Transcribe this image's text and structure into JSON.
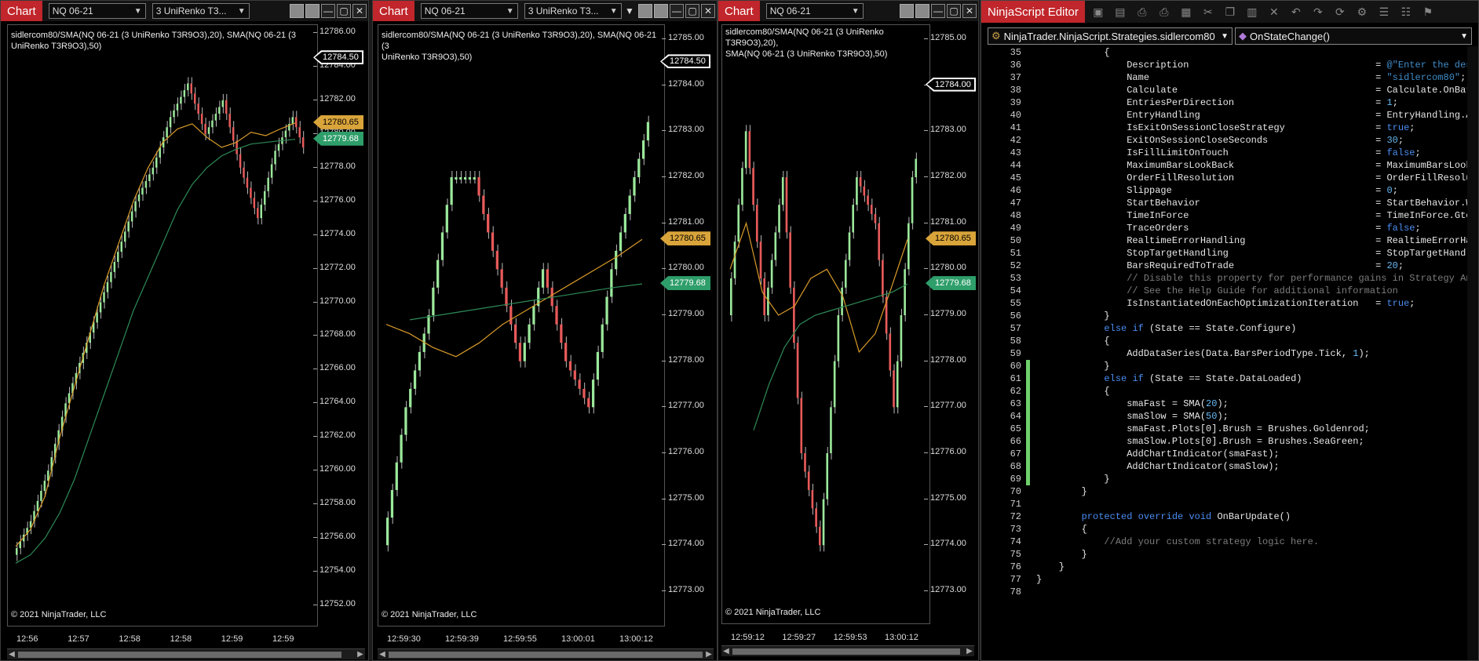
{
  "charts": [
    {
      "tab": "Chart",
      "instrument": "NQ 06-21",
      "bartype": "3 UniRenko T3...",
      "legend1": "sidlercom80/SMA(NQ 06-21 (3 UniRenko T3R9O3),20), SMA(NQ 06-21 (3",
      "legend2": "UniRenko T3R9O3),50)",
      "copyright": "© 2021 NinjaTrader, LLC",
      "ticks": [
        "12786.00",
        "12784.00",
        "12782.00",
        "12780.00",
        "12778.00",
        "12776.00",
        "12774.00",
        "12772.00",
        "12770.00",
        "12768.00",
        "12766.00",
        "12764.00",
        "12762.00",
        "12760.00",
        "12758.00",
        "12756.00",
        "12754.00",
        "12752.00"
      ],
      "last": "12784.50",
      "fast": "12780.65",
      "slow": "12779.68",
      "times": [
        "12:56",
        "12:57",
        "12:58",
        "12:58",
        "12:59",
        "12:59"
      ]
    },
    {
      "tab": "Chart",
      "instrument": "NQ 06-21",
      "bartype": "3 UniRenko T3...",
      "legend1": "sidlercom80/SMA(NQ 06-21 (3 UniRenko T3R9O3),20), SMA(NQ 06-21 (3",
      "legend2": "UniRenko T3R9O3),50)",
      "copyright": "© 2021 NinjaTrader, LLC",
      "ticks": [
        "12785.00",
        "12784.00",
        "12783.00",
        "12782.00",
        "12781.00",
        "12780.00",
        "12779.00",
        "12778.00",
        "12777.00",
        "12776.00",
        "12775.00",
        "12774.00",
        "12773.00"
      ],
      "last": "12784.50",
      "fast": "12780.65",
      "slow": "12779.68",
      "times": [
        "12:59:30",
        "12:59:39",
        "12:59:55",
        "13:00:01",
        "13:00:12"
      ]
    },
    {
      "tab": "Chart",
      "instrument": "NQ 06-21",
      "legend1": "sidlercom80/SMA(NQ 06-21 (3 UniRenko T3R9O3),20),",
      "legend2": "SMA(NQ 06-21 (3 UniRenko T3R9O3),50)",
      "copyright": "© 2021 NinjaTrader, LLC",
      "ticks": [
        "12785.00",
        "12784.00",
        "12783.00",
        "12782.00",
        "12781.00",
        "12780.00",
        "12779.00",
        "12778.00",
        "12777.00",
        "12776.00",
        "12775.00",
        "12774.00",
        "12773.00"
      ],
      "last": "12784.00",
      "fast": "12780.65",
      "slow": "12779.68",
      "times": [
        "12:59:12",
        "12:59:27",
        "12:59:53",
        "13:00:12"
      ]
    }
  ],
  "editor": {
    "title": "NinjaScript Editor",
    "class_combo": "NinjaTrader.NinjaScript.Strategies.sidlercom80",
    "method_combo": "OnStateChange()",
    "first_line": 35,
    "lines": [
      "            {",
      "                Description                                 = @\"Enter the des",
      "                Name                                        = \"sidlercom80\";",
      "                Calculate                                   = Calculate.OnBar",
      "                EntriesPerDirection                         = 1;",
      "                EntryHandling                               = EntryHandling.A",
      "                IsExitOnSessionCloseStrategy                = true;",
      "                ExitOnSessionCloseSeconds                   = 30;",
      "                IsFillLimitOnTouch                          = false;",
      "                MaximumBarsLookBack                         = MaximumBarsLook",
      "                OrderFillResolution                         = OrderFillResolu",
      "                Slippage                                    = 0;",
      "                StartBehavior                               = StartBehavior.W",
      "                TimeInForce                                 = TimeInForce.Gtc",
      "                TraceOrders                                 = false;",
      "                RealtimeErrorHandling                       = RealtimeErrorHa",
      "                StopTargetHandling                          = StopTargetHandl",
      "                BarsRequiredToTrade                         = 20;",
      "                // Disable this property for performance gains in Strategy An",
      "                // See the Help Guide for additional information",
      "                IsInstantiatedOnEachOptimizationIteration   = true;",
      "            }",
      "            else if (State == State.Configure)",
      "            {",
      "                AddDataSeries(Data.BarsPeriodType.Tick, 1);",
      "            }",
      "            else if (State == State.DataLoaded)",
      "            {",
      "                smaFast = SMA(20);",
      "                smaSlow = SMA(50);",
      "                smaFast.Plots[0].Brush = Brushes.Goldenrod;",
      "                smaSlow.Plots[0].Brush = Brushes.SeaGreen;",
      "                AddChartIndicator(smaFast);",
      "                AddChartIndicator(smaSlow);",
      "            }",
      "        }",
      "",
      "        protected override void OnBarUpdate()",
      "        {",
      "            //Add your custom strategy logic here.",
      "        }",
      "    }",
      "}",
      ""
    ]
  },
  "colors": {
    "up": "#9be89b",
    "down": "#e85a5a",
    "fast": "#d89a2a",
    "slow": "#2e8b57",
    "changed": "#6fd16a",
    "tab": "#c0262b"
  },
  "chart_data": [
    {
      "type": "line",
      "series": [
        {
          "values": [
            12755,
            12757,
            12760,
            12764,
            12767,
            12770,
            12773,
            12776,
            12778,
            12781,
            12783,
            12780,
            12782,
            12778,
            12775,
            12779,
            12781,
            12778,
            12781,
            12784
          ]
        },
        {
          "values": [
            12755.5,
            12756.5,
            12758.5,
            12762,
            12765,
            12768,
            12771,
            12773.5,
            12776,
            12778,
            12779.5,
            12780.3,
            12780.6,
            12779.8,
            12779.2,
            12779.5,
            12780.1,
            12779.9,
            12780.3,
            12780.65
          ]
        },
        {
          "values": [
            12754.5,
            12755,
            12756,
            12757.5,
            12759.5,
            12762,
            12764.5,
            12767,
            12769.5,
            12771.5,
            12773.5,
            12775.5,
            12777,
            12778,
            12778.7,
            12779.1,
            12779.4,
            12779.5,
            12779.6,
            12779.68
          ]
        }
      ]
    },
    {
      "type": "line",
      "series": [
        {
          "values": [
            12774,
            12777,
            12779,
            12782,
            12782,
            12780,
            12778,
            12780,
            12778,
            12777,
            12780,
            12782,
            12784,
            12784.5
          ]
        },
        {
          "values": [
            12778.8,
            12778.6,
            12778.3,
            12778.1,
            12778.4,
            12778.8,
            12779.1,
            12779.4,
            12779.7,
            12780,
            12780.3,
            12780.65
          ]
        },
        {
          "values": [
            12778.9,
            12779,
            12779.1,
            12779.2,
            12779.3,
            12779.4,
            12779.5,
            12779.6,
            12779.68
          ]
        }
      ]
    },
    {
      "type": "line",
      "series": [
        {
          "values": [
            12779,
            12783,
            12779,
            12782,
            12776,
            12774,
            12779,
            12782,
            12781,
            12777,
            12782,
            12784
          ]
        },
        {
          "values": [
            12780,
            12781,
            12779.5,
            12779,
            12779.2,
            12779.8,
            12780,
            12779.4,
            12778.2,
            12778.6,
            12779.6,
            12780.65
          ]
        },
        {
          "values": [
            12776.5,
            12777.5,
            12778.3,
            12778.8,
            12779,
            12779.1,
            12779.2,
            12779.3,
            12779.4,
            12779.5,
            12779.68
          ]
        }
      ]
    }
  ]
}
